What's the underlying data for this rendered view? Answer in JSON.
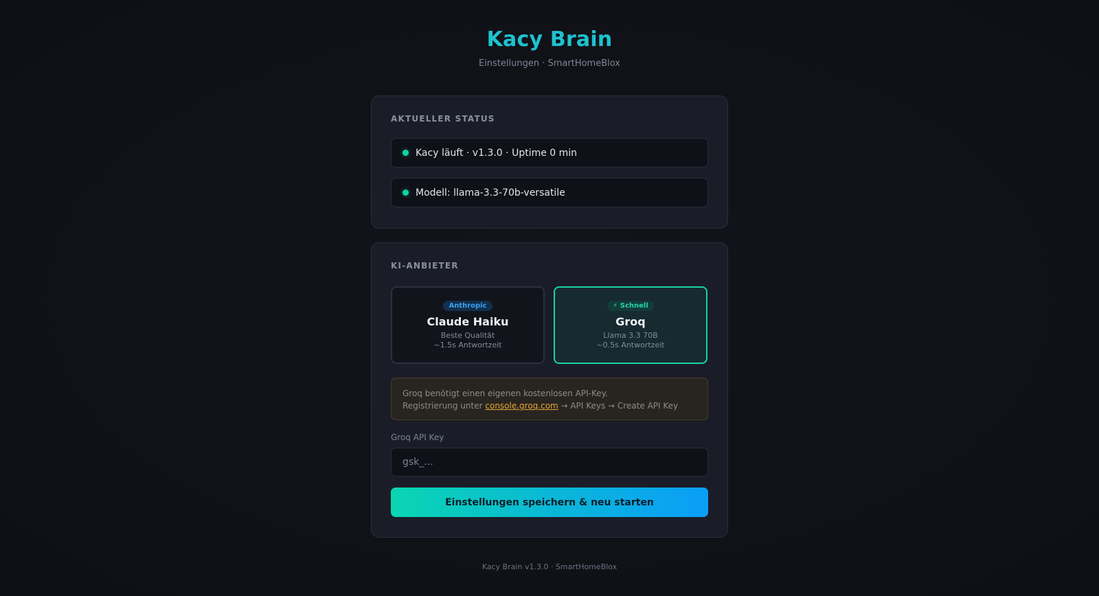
{
  "header": {
    "title": "Kacy Brain",
    "subtitle": "Einstellungen · SmartHomeBlox"
  },
  "status": {
    "section_label": "AKTUELLER STATUS",
    "rows": [
      {
        "text": "Kacy läuft · v1.3.0 · Uptime 0 min",
        "color": "#10d3a6"
      },
      {
        "text": "Modell: llama-3.3-70b-versatile",
        "color": "#10d3a6"
      }
    ]
  },
  "provider": {
    "section_label": "KI-ANBIETER",
    "options": [
      {
        "badge": "Anthropic",
        "name": "Claude Haiku",
        "line1": "Beste Qualität",
        "line2": "~1.5s Antwortzeit",
        "selected": false
      },
      {
        "badge": "⚡ Schnell",
        "name": "Groq",
        "line1": "Llama 3.3 70B",
        "line2": "~0.5s Antwortzeit",
        "selected": true
      }
    ],
    "notice": {
      "line1": "Groq benötigt einen eigenen kostenlosen API-Key.",
      "line2_prefix": "Registrierung unter ",
      "link": "console.groq.com",
      "line2_suffix": " → API Keys → Create API Key"
    },
    "api_key_label": "Groq API Key",
    "api_key_placeholder": "gsk_...",
    "api_key_value": "",
    "save_button": "Einstellungen speichern & neu starten"
  },
  "footer": "Kacy Brain v1.3.0 · SmartHomeBlox",
  "colors": {
    "accent": "#1ec2cf",
    "status_ok": "#10d3a6",
    "selected_border": "#19d3a6",
    "notice_link": "#e9a431"
  }
}
